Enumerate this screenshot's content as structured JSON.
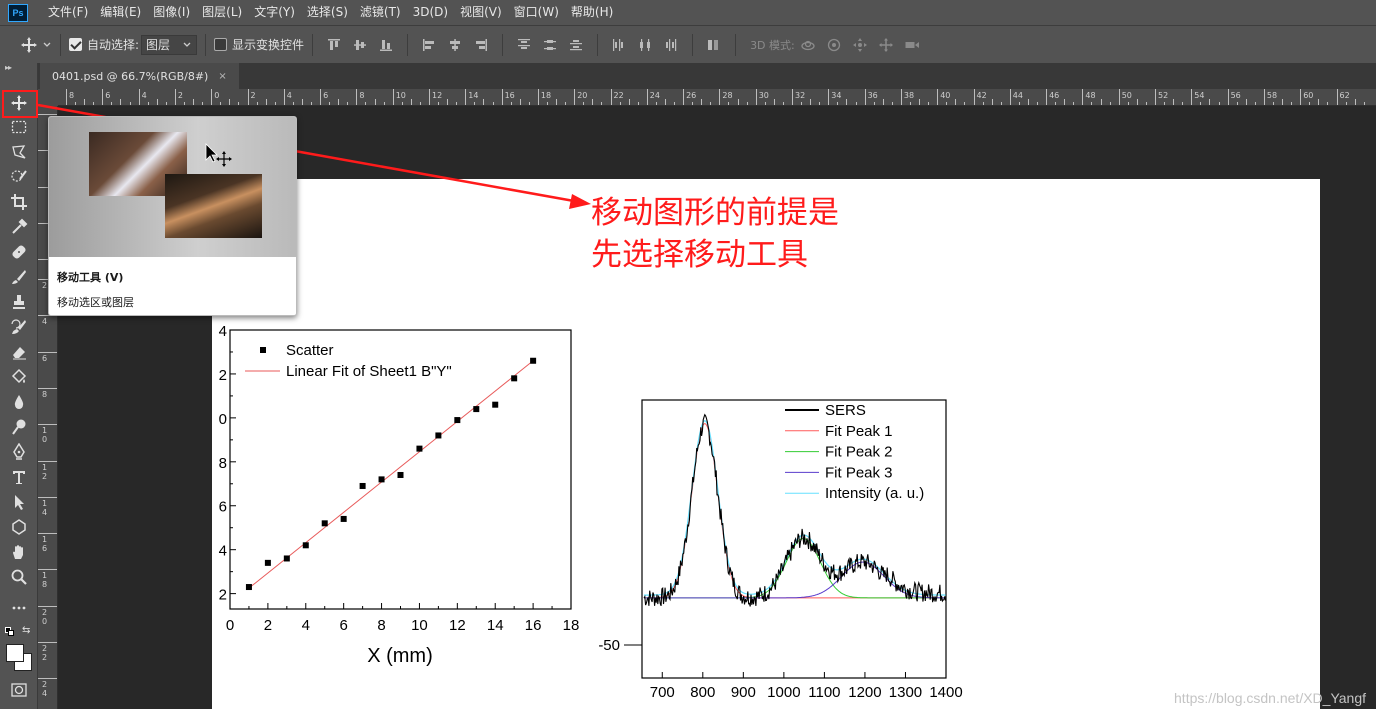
{
  "app": {
    "logo": "Ps"
  },
  "menu": [
    "文件(F)",
    "编辑(E)",
    "图像(I)",
    "图层(L)",
    "文字(Y)",
    "选择(S)",
    "滤镜(T)",
    "3D(D)",
    "视图(V)",
    "窗口(W)",
    "帮助(H)"
  ],
  "options": {
    "auto_select_label": "自动选择:",
    "auto_select_checked": true,
    "auto_select_value": "图层",
    "show_transform_label": "显示变换控件",
    "show_transform_checked": false,
    "mode_3d_label": "3D 模式:"
  },
  "tab": {
    "title": "0401.psd @ 66.7%(RGB/8#)",
    "close": "×"
  },
  "rulers": {
    "top": [
      "8",
      "6",
      "4",
      "2",
      "0",
      "2",
      "4",
      "6",
      "8",
      "10",
      "12",
      "14",
      "16",
      "18",
      "20",
      "22",
      "24",
      "26",
      "28",
      "30",
      "32",
      "34",
      "36",
      "38",
      "40",
      "42",
      "44",
      "46",
      "48",
      "50",
      "52",
      "54",
      "56",
      "58",
      "60",
      "62"
    ],
    "left": [
      "2",
      "4",
      "6",
      "8",
      "1\n0",
      "1\n2",
      "1\n4",
      "1\n6",
      "1\n8",
      "2\n0",
      "2\n2",
      "2\n4"
    ]
  },
  "tooltip": {
    "title": "移动工具 (V)",
    "description": "移动选区或图层"
  },
  "annotation": {
    "line1": "移动图形的前提是",
    "line2": "先选择移动工具"
  },
  "watermark": "https://blog.csdn.net/XD_Yangf",
  "colors": {
    "annotation": "#ff1b1b",
    "fit_line": "#e85a5a",
    "peak1": "#ff5a5a",
    "peak2": "#33cc33",
    "peak3": "#5a3ccc",
    "intensity": "#66e0ff",
    "sers": "#000000"
  },
  "chart_data": [
    {
      "type": "scatter",
      "xlabel": "X (mm)",
      "xlim": [
        0,
        18
      ],
      "ylim": [
        1.3,
        14
      ],
      "x_ticks": [
        "0",
        "2",
        "4",
        "6",
        "8",
        "10",
        "12",
        "14",
        "16",
        "18"
      ],
      "y_ticks": [
        "2",
        "4",
        "6",
        "8",
        "0",
        "2",
        "4"
      ],
      "series": [
        {
          "name": "Scatter",
          "x": [
            1,
            2,
            3,
            4,
            5,
            6,
            7,
            8,
            9,
            10,
            11,
            12,
            13,
            14,
            15,
            16
          ],
          "y": [
            2.3,
            3.4,
            3.6,
            4.2,
            5.2,
            5.4,
            6.9,
            7.2,
            7.4,
            8.6,
            9.2,
            9.9,
            10.4,
            10.6,
            11.8,
            12.6
          ]
        },
        {
          "name": "Linear Fit of Sheet1 B\"Y\"",
          "x": [
            1,
            16
          ],
          "y": [
            2.25,
            12.6
          ]
        }
      ],
      "legend": "top-left",
      "grid": false
    },
    {
      "type": "line",
      "xlim": [
        650,
        1400
      ],
      "x_ticks": [
        "700",
        "800",
        "900",
        "1000",
        "1100",
        "1200",
        "1300",
        "1400"
      ],
      "y_ticks": [
        "-50"
      ],
      "series": [
        {
          "name": "SERS"
        },
        {
          "name": "Fit Peak 1",
          "center": 805,
          "amplitude": 185,
          "width": 32
        },
        {
          "name": "Fit Peak 2",
          "center": 1048,
          "amplitude": 63,
          "width": 42
        },
        {
          "name": "Fit Peak 3",
          "center": 1195,
          "amplitude": 38,
          "width": 52
        },
        {
          "name": "Intensity (a. u.)"
        }
      ],
      "baseline": 0,
      "legend": "top-right",
      "grid": false
    }
  ]
}
